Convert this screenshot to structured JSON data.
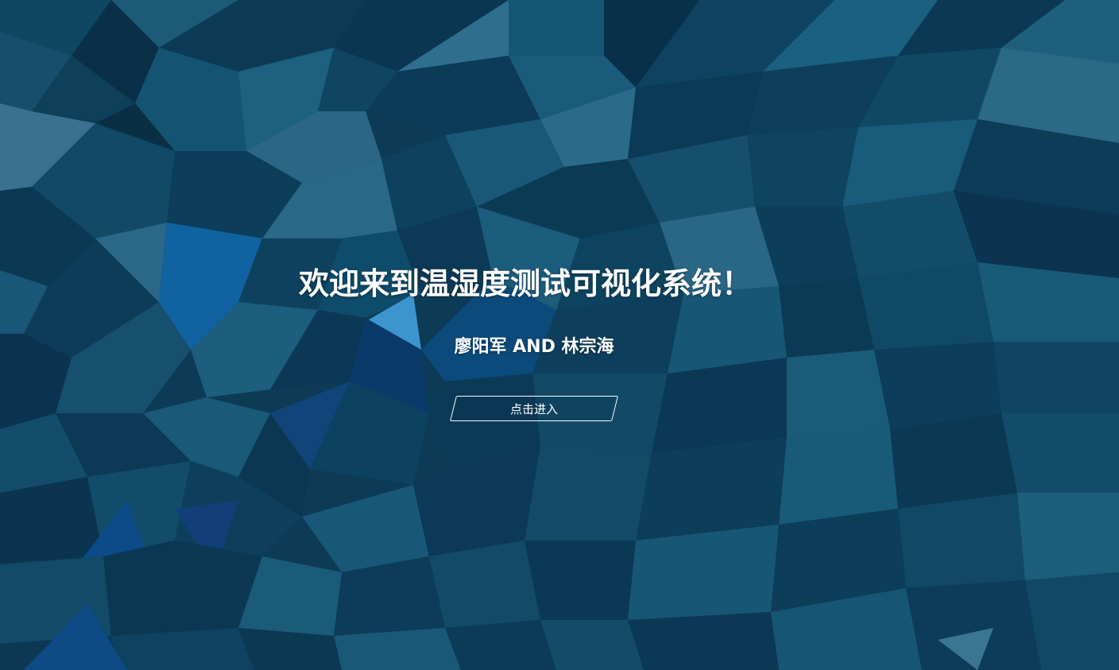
{
  "welcome": {
    "title": "欢迎来到温湿度测试可视化系统！",
    "authors": "廖阳军 AND 林宗海"
  },
  "actions": {
    "enter_label": "点击进入"
  },
  "colors": {
    "background": "#0b3550",
    "text": "#ffffff",
    "accent_blue": "#3a8fc9"
  }
}
